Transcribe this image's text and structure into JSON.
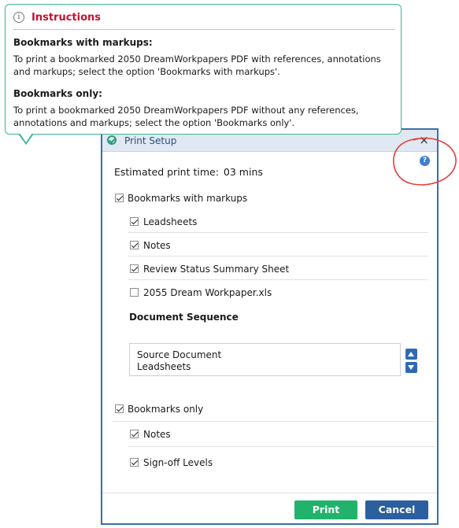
{
  "instructions": {
    "title": "Instructions",
    "info_glyph": "i",
    "section1_heading": "Bookmarks with markups:",
    "section1_text": "To print a bookmarked 2050 DreamWorkpapers PDF with references, annotations and markups; select the option 'Bookmarks with markups'.",
    "section2_heading": "Bookmarks only:",
    "section2_text": "To print a bookmarked 2050 DreamWorkpapers PDF without any references, annotations and markups; select the option 'Bookmarks only'."
  },
  "dialog": {
    "title": "Print Setup",
    "close_glyph": "×",
    "help_glyph": "?",
    "estimated_label": "Estimated print time:",
    "estimated_value": "03 mins",
    "bookmarks_with_markups": {
      "label": "Bookmarks with markups",
      "checked": true
    },
    "markup_options": [
      {
        "label": "Leadsheets",
        "checked": true
      },
      {
        "label": "Notes",
        "checked": true
      },
      {
        "label": "Review Status Summary Sheet",
        "checked": true
      },
      {
        "label": "2055 Dream Workpaper.xls",
        "checked": false
      }
    ],
    "sequence": {
      "title": "Document Sequence",
      "items": [
        "Source Document",
        "Leadsheets"
      ]
    },
    "bookmarks_only": {
      "label": "Bookmarks only",
      "checked": true
    },
    "only_options": [
      {
        "label": "Notes",
        "checked": true
      },
      {
        "label": "Sign-off Levels",
        "checked": true
      }
    ],
    "print_label": "Print",
    "cancel_label": "Cancel"
  },
  "colors": {
    "accent_green": "#21b36c",
    "accent_blue": "#2b5f9e",
    "title_red": "#c8102e",
    "annotation_red": "#e0403a"
  }
}
